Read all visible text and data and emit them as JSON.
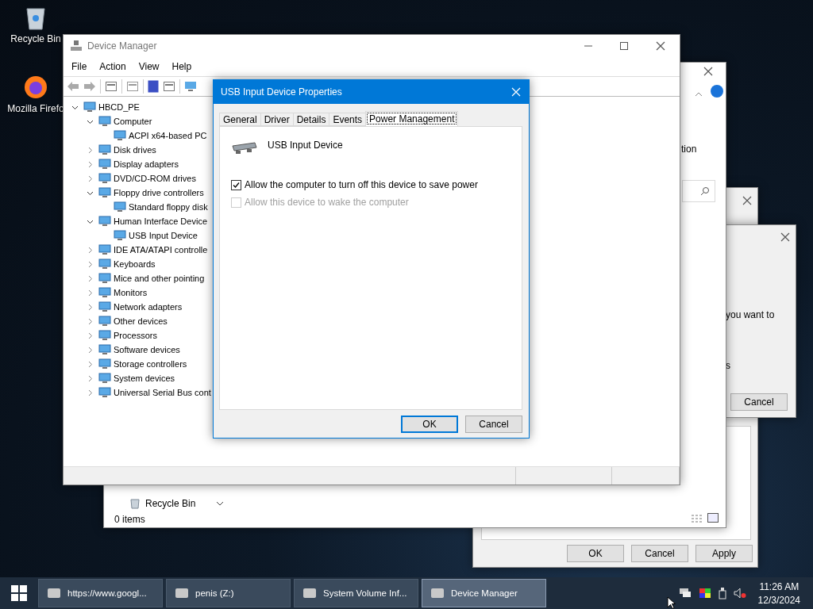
{
  "desktop_icons": [
    {
      "label": "Recycle Bin"
    },
    {
      "label": "Mozilla Firefo"
    }
  ],
  "back_properties_window": {
    "buttons": [
      "OK",
      "Cancel",
      "Apply"
    ]
  },
  "back_dialog": {
    "text_1": "you want to",
    "text_2": "s",
    "button": "Cancel"
  },
  "explorer_window": {
    "ribbon_text": "tion",
    "nav_item": "Recycle Bin",
    "status": "0 items"
  },
  "device_manager": {
    "title": "Device Manager",
    "menu": [
      "File",
      "Action",
      "View",
      "Help"
    ],
    "tree": [
      {
        "label": "HBCD_PE",
        "expanded": true,
        "children": [
          {
            "label": "Computer",
            "expanded": true,
            "children": [
              {
                "label": "ACPI x64-based PC"
              }
            ]
          },
          {
            "label": "Disk drives",
            "expanded": false
          },
          {
            "label": "Display adapters",
            "expanded": false
          },
          {
            "label": "DVD/CD-ROM drives",
            "expanded": false
          },
          {
            "label": "Floppy drive controllers",
            "expanded": true,
            "children": [
              {
                "label": "Standard floppy disk"
              }
            ]
          },
          {
            "label": "Human Interface Device",
            "expanded": true,
            "children": [
              {
                "label": "USB Input Device"
              }
            ]
          },
          {
            "label": "IDE ATA/ATAPI controlle",
            "expanded": false
          },
          {
            "label": "Keyboards",
            "expanded": false
          },
          {
            "label": "Mice and other pointing",
            "expanded": false
          },
          {
            "label": "Monitors",
            "expanded": false
          },
          {
            "label": "Network adapters",
            "expanded": false
          },
          {
            "label": "Other devices",
            "expanded": false
          },
          {
            "label": "Processors",
            "expanded": false
          },
          {
            "label": "Software devices",
            "expanded": false
          },
          {
            "label": "Storage controllers",
            "expanded": false
          },
          {
            "label": "System devices",
            "expanded": false
          },
          {
            "label": "Universal Serial Bus cont",
            "expanded": false
          }
        ]
      }
    ]
  },
  "properties_dialog": {
    "title": "USB Input Device Properties",
    "tabs": [
      {
        "label": "General",
        "selected": false
      },
      {
        "label": "Driver",
        "selected": false
      },
      {
        "label": "Details",
        "selected": false
      },
      {
        "label": "Events",
        "selected": false
      },
      {
        "label": "Power Management",
        "selected": true
      }
    ],
    "device_name": "USB Input Device",
    "options": [
      {
        "label": "Allow the computer to turn off this device to save power",
        "checked": true,
        "disabled": false
      },
      {
        "label": "Allow this device to wake the computer",
        "checked": false,
        "disabled": true
      }
    ],
    "buttons": [
      {
        "label": "OK",
        "default": true
      },
      {
        "label": "Cancel",
        "default": false
      }
    ]
  },
  "taskbar": {
    "items": [
      {
        "label": "https://www.googl...",
        "selected": false
      },
      {
        "label": "penis (Z:)",
        "selected": false
      },
      {
        "label": "System Volume Inf...",
        "selected": false
      },
      {
        "label": "Device Manager",
        "selected": true
      }
    ],
    "time": "11:26 AM",
    "date": "12/3/2024"
  }
}
